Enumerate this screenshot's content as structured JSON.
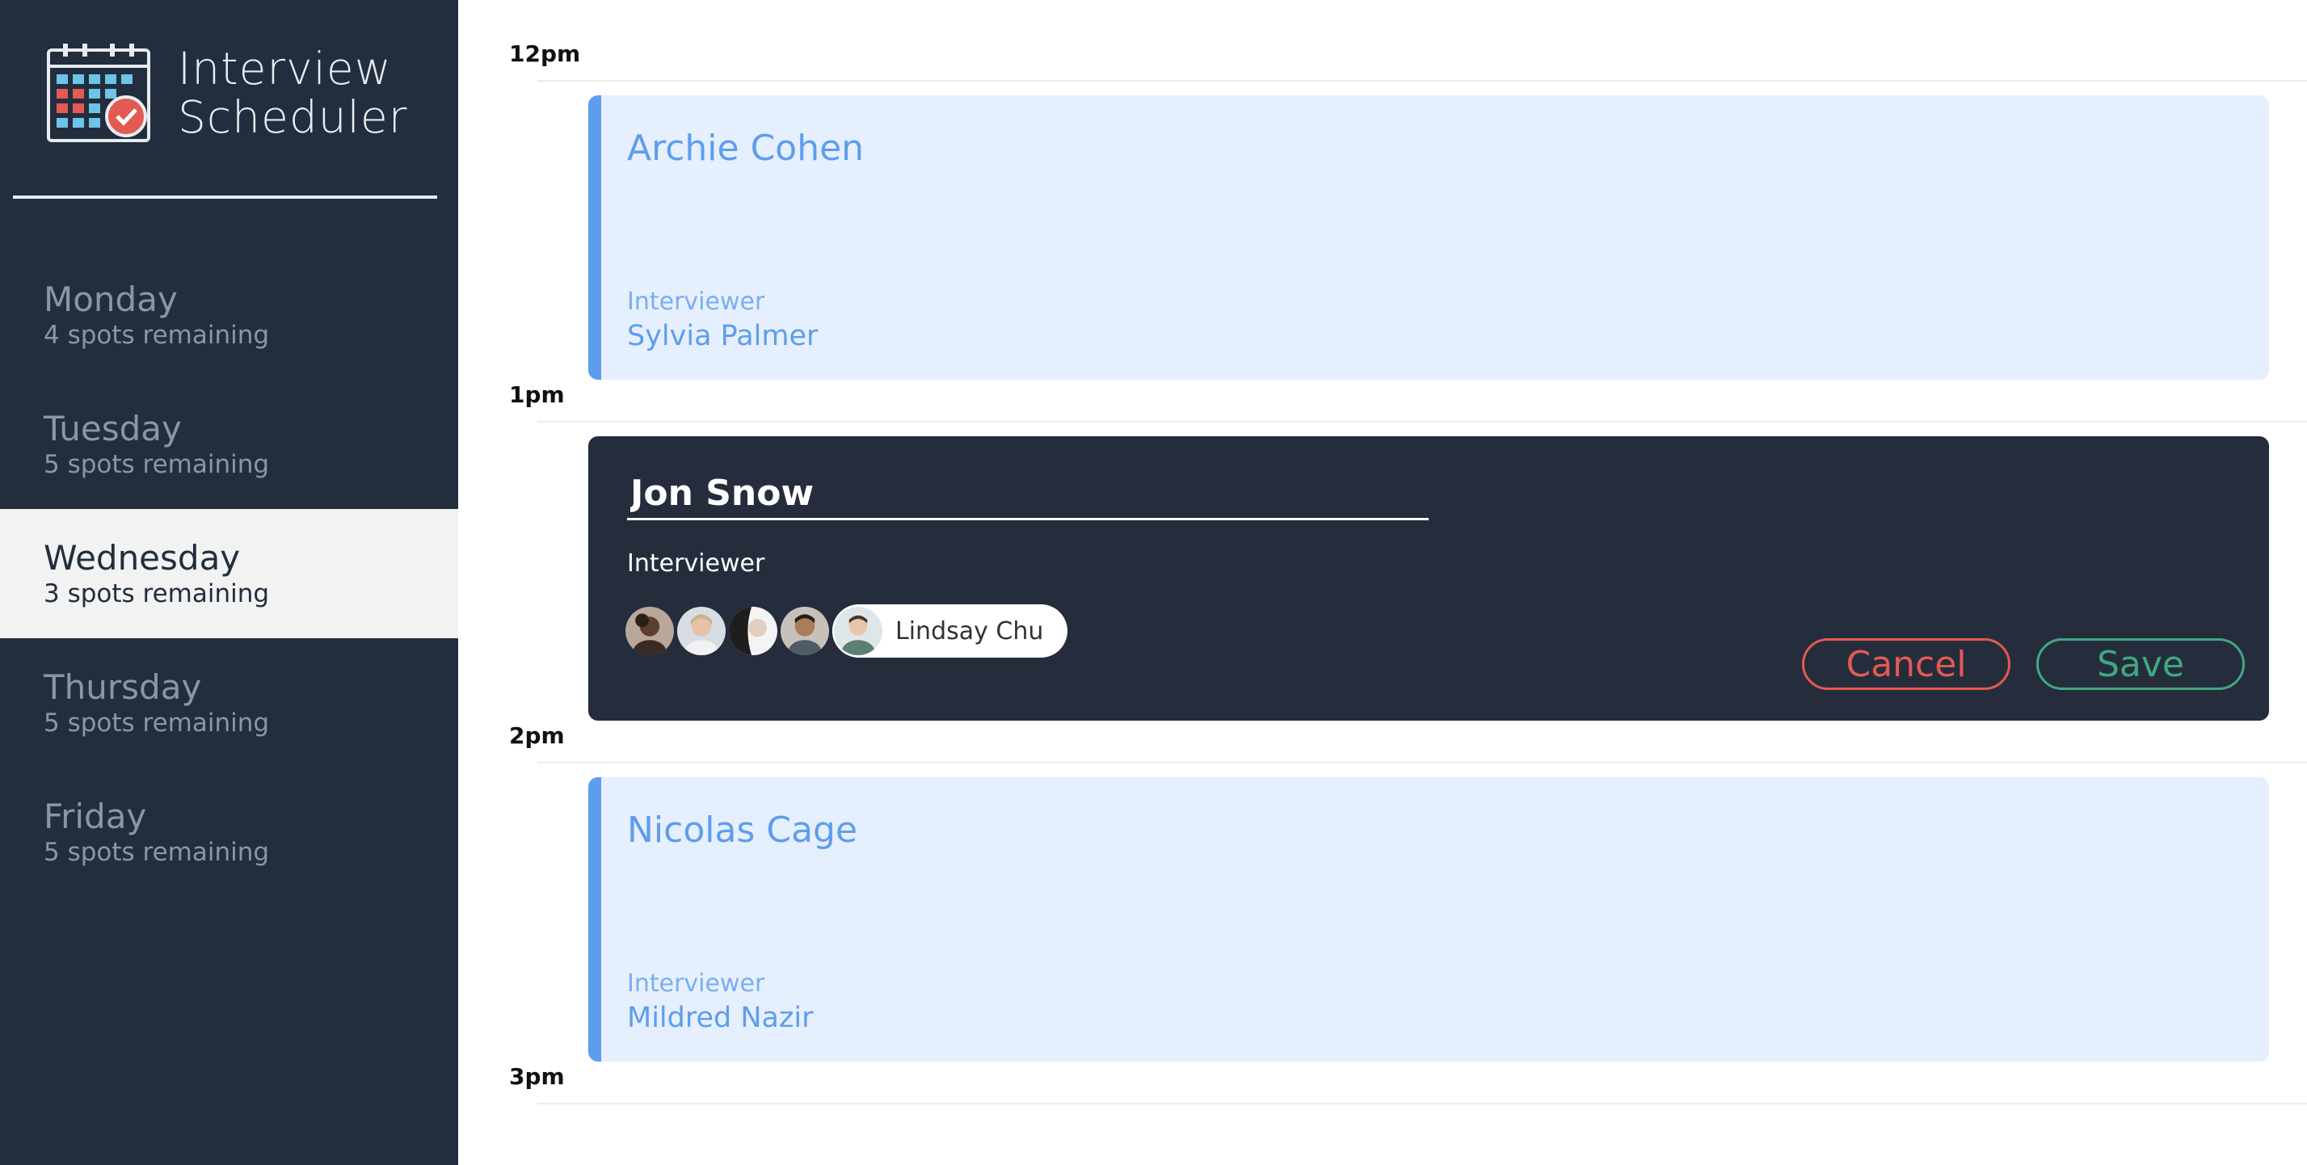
{
  "brand": {
    "line1": "Interview",
    "line2": "Scheduler"
  },
  "days": [
    {
      "name": "Monday",
      "spots": "4 spots remaining",
      "selected": false
    },
    {
      "name": "Tuesday",
      "spots": "5 spots remaining",
      "selected": false
    },
    {
      "name": "Wednesday",
      "spots": "3 spots remaining",
      "selected": true
    },
    {
      "name": "Thursday",
      "spots": "5 spots remaining",
      "selected": false
    },
    {
      "name": "Friday",
      "spots": "5 spots remaining",
      "selected": false
    }
  ],
  "times": [
    "12pm",
    "1pm",
    "2pm",
    "3pm"
  ],
  "appointments": [
    {
      "student": "Archie Cohen",
      "interviewer_label": "Interviewer",
      "interviewer": "Sylvia Palmer"
    },
    {
      "student": "Nicolas Cage",
      "interviewer_label": "Interviewer",
      "interviewer": "Mildred Nazir"
    }
  ],
  "form": {
    "student_value": "Jon Snow",
    "interviewer_label": "Interviewer",
    "selected_interviewer": "Lindsay Chu",
    "cancel_label": "Cancel",
    "save_label": "Save"
  },
  "colors": {
    "sidebar_bg": "#222e3d",
    "appointment_bg": "#e6effd",
    "appointment_accent": "#5e9ded",
    "form_bg": "#252d3c",
    "cancel": "#e35a52",
    "save": "#3fa882"
  }
}
